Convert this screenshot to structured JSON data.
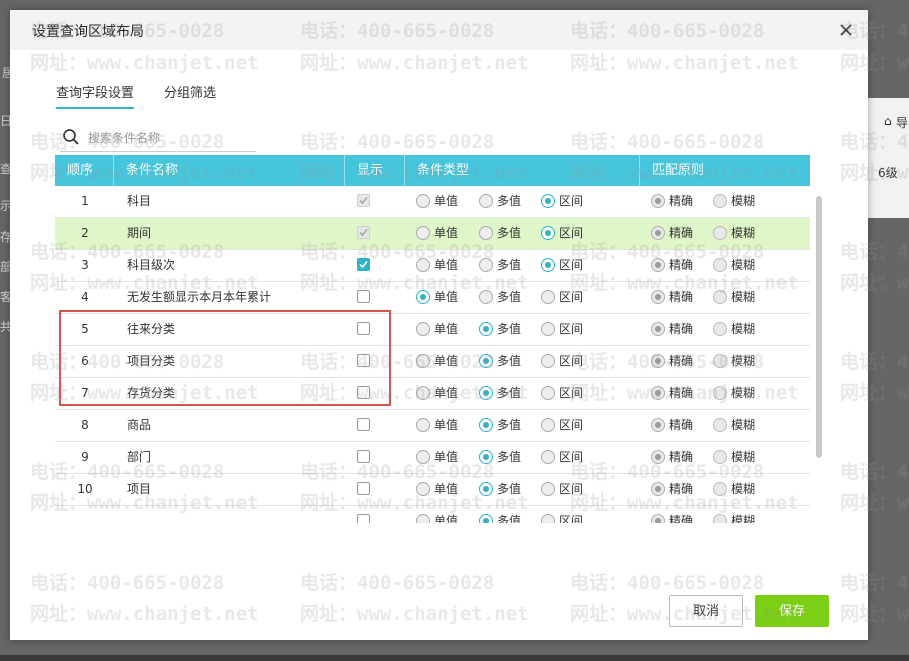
{
  "background": {
    "fragments": [
      "居",
      "日",
      "查",
      "示",
      "存",
      "部",
      "客",
      "共"
    ],
    "right_panel": {
      "icon_text": "⌂",
      "label_1": "导",
      "label_2": "6级"
    }
  },
  "dialog": {
    "title": "设置查询区域布局",
    "tabs": [
      {
        "label": "查询字段设置",
        "active": true
      },
      {
        "label": "分组筛选",
        "active": false
      }
    ],
    "search": {
      "placeholder": "搜索条件名称",
      "value": ""
    },
    "columns": {
      "order": "顺序",
      "name": "条件名称",
      "show": "显示",
      "type": "条件类型",
      "match": "匹配原则"
    },
    "type_options": [
      "单值",
      "多值",
      "区间"
    ],
    "match_options": [
      "精确",
      "模糊"
    ],
    "rows": [
      {
        "index": "1",
        "name": "科目",
        "show": "checked-disabled",
        "type": "区间",
        "match": "精确",
        "highlight": false
      },
      {
        "index": "2",
        "name": "期间",
        "show": "checked-disabled",
        "type": "区间",
        "match": "精确",
        "highlight": true
      },
      {
        "index": "3",
        "name": "科目级次",
        "show": "checked",
        "type": "区间",
        "match": "精确",
        "highlight": false
      },
      {
        "index": "4",
        "name": "无发生额显示本月本年累计",
        "show": "unchecked",
        "type": "单值",
        "match": "精确",
        "highlight": false
      },
      {
        "index": "5",
        "name": "往来分类",
        "show": "unchecked",
        "type": "多值",
        "match": "精确",
        "highlight": false
      },
      {
        "index": "6",
        "name": "项目分类",
        "show": "unchecked",
        "type": "多值",
        "match": "精确",
        "highlight": false
      },
      {
        "index": "7",
        "name": "存货分类",
        "show": "unchecked",
        "type": "多值",
        "match": "精确",
        "highlight": false
      },
      {
        "index": "8",
        "name": "商品",
        "show": "unchecked",
        "type": "多值",
        "match": "精确",
        "highlight": false
      },
      {
        "index": "9",
        "name": "部门",
        "show": "unchecked",
        "type": "多值",
        "match": "精确",
        "highlight": false
      },
      {
        "index": "10",
        "name": "项目",
        "show": "unchecked",
        "type": "多值",
        "match": "精确",
        "highlight": false
      },
      {
        "index": "",
        "name": "",
        "show": "unchecked",
        "type": "多值",
        "match": "精确",
        "highlight": false
      }
    ],
    "buttons": {
      "cancel": "取消",
      "save": "保存"
    }
  },
  "watermark": {
    "phone": "电话：400-665-0028",
    "site": "网址：www.chanjet.net"
  },
  "colors": {
    "header": "#46c6dd",
    "accent": "#2fb3c9",
    "save": "#7ccf14",
    "highlight_row": "#dff7c8",
    "annotation": "#d9534f"
  }
}
